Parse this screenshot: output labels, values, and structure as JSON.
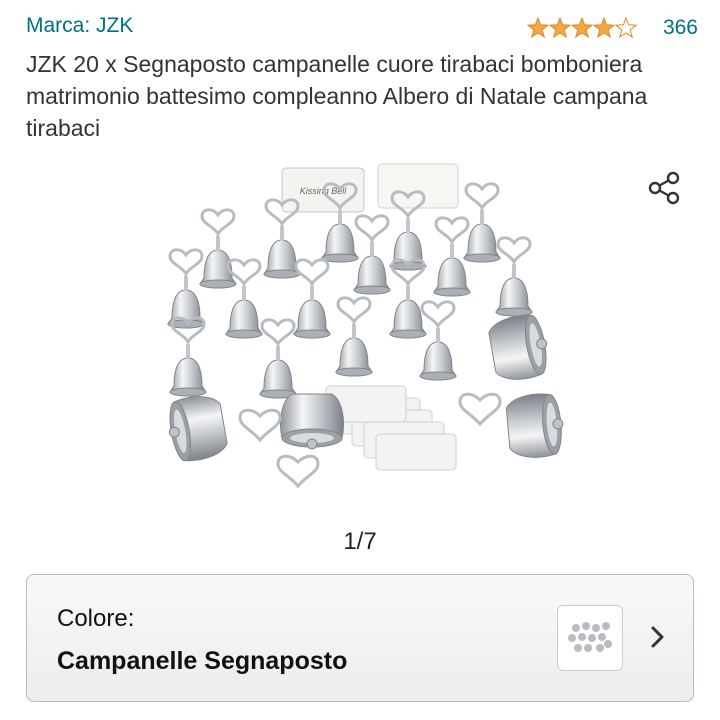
{
  "header": {
    "brand": "Marca: JZK",
    "rating_value": 4.5,
    "rating_count": "366"
  },
  "product": {
    "title": "JZK 20 x Segnaposto campanelle cuore tirabaci bomboniera matrimonio battesimo compleanno Albero di Natale campana tirabaci",
    "image_counter": "1/7",
    "card_text": "Kissing Bell"
  },
  "variant": {
    "label": "Colore:",
    "value": "Campanelle Segnaposto"
  },
  "icons": {
    "share": "share-icon",
    "star": "star-icon",
    "chevron": "chevron-right-icon"
  },
  "colors": {
    "link": "#007185",
    "star": "#f3a847"
  }
}
